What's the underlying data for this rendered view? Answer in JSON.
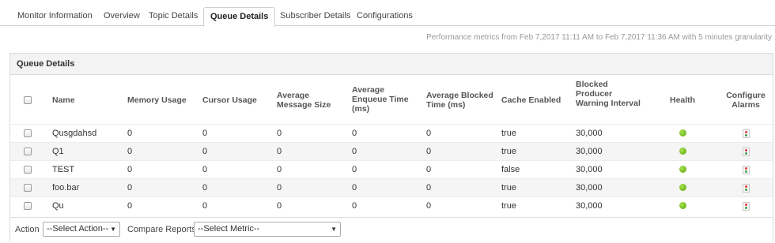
{
  "tabs": [
    {
      "label": "Monitor Information"
    },
    {
      "label": "Overview"
    },
    {
      "label": "Topic Details"
    },
    {
      "label": "Queue Details",
      "active": true
    },
    {
      "label": "Subscriber Details"
    },
    {
      "label": "Configurations"
    }
  ],
  "performance_text": "Performance metrics from Feb 7,2017 11:11 AM to Feb 7,2017 11:36 AM with 5 minutes granularity",
  "panel_title": "Queue Details",
  "columns": {
    "name": "Name",
    "memory_usage": "Memory Usage",
    "cursor_usage": "Cursor Usage",
    "avg_message_size": [
      "Average",
      "Message Size"
    ],
    "avg_enqueue_time": [
      "Average",
      "Enqueue Time",
      "(ms)"
    ],
    "avg_blocked_time": [
      "Average Blocked",
      "Time  (ms)"
    ],
    "cache_enabled": "Cache Enabled",
    "blocked_producer": [
      "Blocked",
      "Producer",
      "Warning Interval"
    ],
    "health": "Health",
    "configure_alarms": [
      "Configure",
      "Alarms"
    ]
  },
  "rows": [
    {
      "name": "Qusgdahsd",
      "memory_usage": "0",
      "cursor_usage": "0",
      "avg_message_size": "0",
      "avg_enqueue_time": "0",
      "avg_blocked_time": "0",
      "cache_enabled": "true",
      "blocked_producer_warning": "30,000",
      "health": "green"
    },
    {
      "name": "Q1",
      "memory_usage": "0",
      "cursor_usage": "0",
      "avg_message_size": "0",
      "avg_enqueue_time": "0",
      "avg_blocked_time": "0",
      "cache_enabled": "true",
      "blocked_producer_warning": "30,000",
      "health": "green"
    },
    {
      "name": "TEST",
      "memory_usage": "0",
      "cursor_usage": "0",
      "avg_message_size": "0",
      "avg_enqueue_time": "0",
      "avg_blocked_time": "0",
      "cache_enabled": "false",
      "blocked_producer_warning": "30,000",
      "health": "green"
    },
    {
      "name": "foo.bar",
      "memory_usage": "0",
      "cursor_usage": "0",
      "avg_message_size": "0",
      "avg_enqueue_time": "0",
      "avg_blocked_time": "0",
      "cache_enabled": "true",
      "blocked_producer_warning": "30,000",
      "health": "green"
    },
    {
      "name": "Qu",
      "memory_usage": "0",
      "cursor_usage": "0",
      "avg_message_size": "0",
      "avg_enqueue_time": "0",
      "avg_blocked_time": "0",
      "cache_enabled": "true",
      "blocked_producer_warning": "30,000",
      "health": "green"
    }
  ],
  "footer": {
    "action_label": "Action",
    "action_select_value": "--Select Action--",
    "compare_label": "Compare Reports",
    "compare_select_value": "--Select Metric--"
  },
  "colors": {
    "health_ok": "#6cbf1a",
    "active_tab_border": "#cfcfcf"
  },
  "icons": {
    "health": "green-status-dot-icon",
    "alarm": "configure-alarm-icon",
    "dropdown": "caret-down-icon"
  }
}
